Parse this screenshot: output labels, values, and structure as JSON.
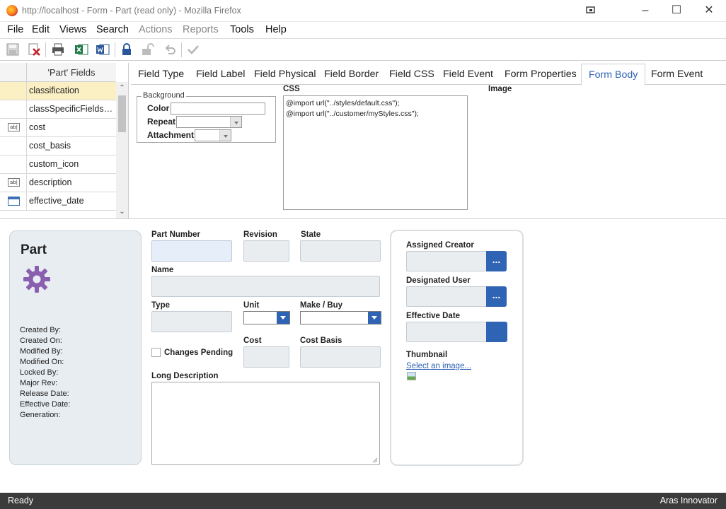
{
  "window": {
    "title": "http://localhost - Form - Part (read only) - Mozilla Firefox"
  },
  "menu": {
    "file": "File",
    "edit": "Edit",
    "views": "Views",
    "search": "Search",
    "actions": "Actions",
    "reports": "Reports",
    "tools": "Tools",
    "help": "Help"
  },
  "fields_panel": {
    "header": "'Part' Fields",
    "items": [
      {
        "label": "classification",
        "icon": "none",
        "selected": true
      },
      {
        "label": "classSpecificFields_b...",
        "icon": "none"
      },
      {
        "label": "cost",
        "icon": "textbox-icon"
      },
      {
        "label": "cost_basis",
        "icon": "none"
      },
      {
        "label": "custom_icon",
        "icon": "none"
      },
      {
        "label": "description",
        "icon": "textbox-icon"
      },
      {
        "label": "effective_date",
        "icon": "calendar-icon"
      }
    ]
  },
  "tabs": [
    {
      "label": "Field Type"
    },
    {
      "label": "Field Label"
    },
    {
      "label": "Field Physical"
    },
    {
      "label": "Field Border"
    },
    {
      "label": "Field CSS"
    },
    {
      "label": "Field Event"
    },
    {
      "label": "Form Properties"
    },
    {
      "label": "Form Body",
      "active": true
    },
    {
      "label": "Form Event"
    }
  ],
  "form_body": {
    "background_legend": "Background",
    "color_label": "Color",
    "repeat_label": "Repeat",
    "attachment_label": "Attachment",
    "css_label": "CSS",
    "css_lines": [
      "@import url(\"../styles/default.css\");",
      "@import url(\"../customer/myStyles.css\");"
    ],
    "image_label": "Image"
  },
  "preview": {
    "title": "Part",
    "meta": [
      "Created By:",
      "Created On:",
      "Modified By:",
      "Modified On:",
      "Locked By:",
      "Major Rev:",
      "Release Date:",
      "Effective Date:",
      "Generation:"
    ],
    "labels": {
      "part_number": "Part Number",
      "revision": "Revision",
      "state": "State",
      "name": "Name",
      "type": "Type",
      "unit": "Unit",
      "make_buy": "Make / Buy",
      "changes_pending": "Changes Pending",
      "cost": "Cost",
      "cost_basis": "Cost Basis",
      "long_description": "Long Description",
      "assigned_creator": "Assigned Creator",
      "designated_user": "Designated User",
      "effective_date": "Effective Date",
      "thumbnail": "Thumbnail",
      "select_image": "Select an image...",
      "ellipsis": "..."
    }
  },
  "status": {
    "left": "Ready",
    "right": "Aras Innovator"
  },
  "colors": {
    "accent": "#2f63b4",
    "status_bar": "#3b3b3b",
    "selected_row": "#fbefc4"
  }
}
